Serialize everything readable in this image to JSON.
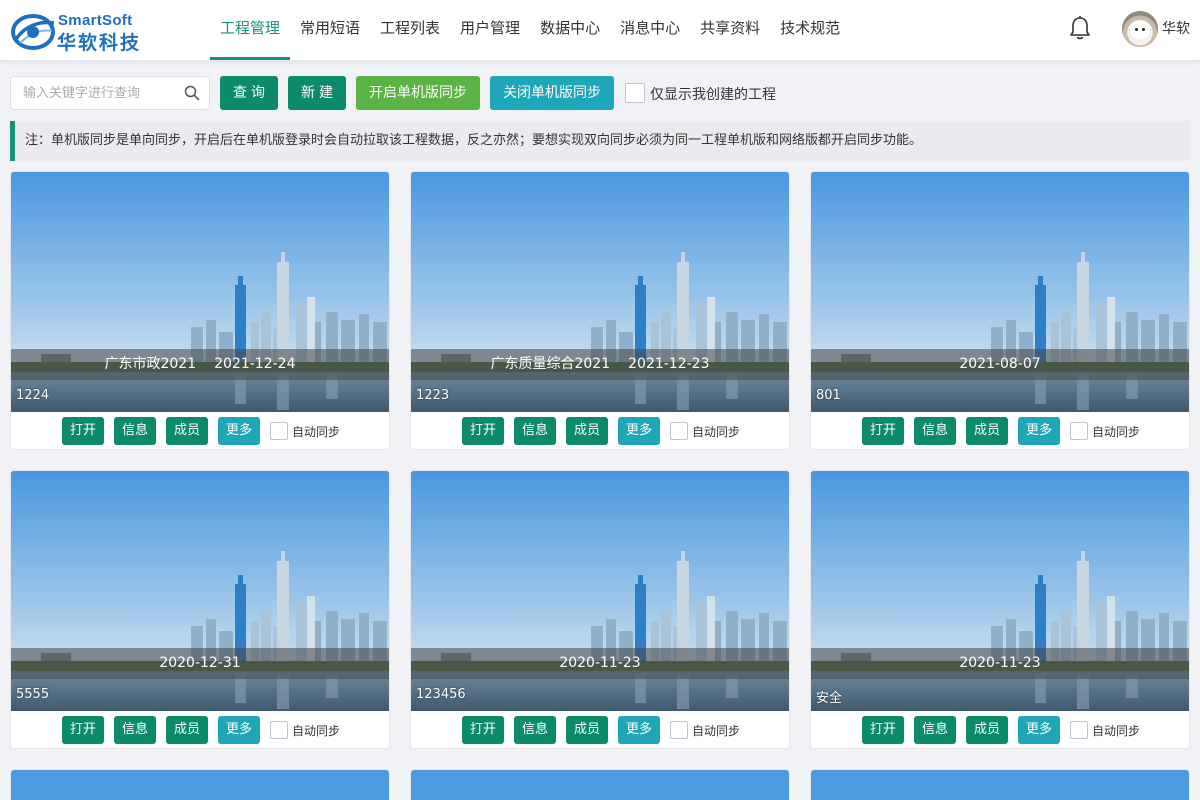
{
  "brand": {
    "name_en": "SmartSoft",
    "name_cn": "华软科技"
  },
  "nav": {
    "items": [
      {
        "label": "工程管理",
        "active": true
      },
      {
        "label": "常用短语",
        "active": false
      },
      {
        "label": "工程列表",
        "active": false
      },
      {
        "label": "用户管理",
        "active": false
      },
      {
        "label": "数据中心",
        "active": false
      },
      {
        "label": "消息中心",
        "active": false
      },
      {
        "label": "共享资料",
        "active": false
      },
      {
        "label": "技术规范",
        "active": false
      }
    ]
  },
  "user": {
    "name": "华软"
  },
  "toolbar": {
    "search_placeholder": "输入关键字进行查询",
    "search_value": "",
    "query_label": "查询",
    "new_label": "新建",
    "open_sync_label": "开启单机版同步",
    "close_sync_label": "关闭单机版同步",
    "only_mine_label": "仅显示我创建的工程",
    "only_mine_checked": false
  },
  "notice": {
    "text": "注：单机版同步是单向同步，开启后在单机版登录时会自动拉取该工程数据，反之亦然；要想实现双向同步必须为同一工程单机版和网络版都开启同步功能。"
  },
  "card_labels": {
    "open": "打开",
    "info": "信息",
    "member": "成员",
    "more": "更多",
    "auto_sync": "自动同步"
  },
  "projects": [
    {
      "name": "广东市政2021",
      "date": "2021-12-24",
      "id": "1224",
      "auto_sync": false
    },
    {
      "name": "广东质量综合2021",
      "date": "2021-12-23",
      "id": "1223",
      "auto_sync": false
    },
    {
      "name": "",
      "date": "2021-08-07",
      "id": "801",
      "auto_sync": false
    },
    {
      "name": "",
      "date": "2020-12-31",
      "id": "5555",
      "auto_sync": false
    },
    {
      "name": "",
      "date": "2020-11-23",
      "id": "123456",
      "auto_sync": false
    },
    {
      "name": "",
      "date": "2020-11-23",
      "id": "安全",
      "auto_sync": false
    }
  ],
  "colors": {
    "primary": "#0c8a6c",
    "active_nav": "#16917a",
    "green_button": "#5bb346",
    "teal_button": "#1ea7b8"
  }
}
